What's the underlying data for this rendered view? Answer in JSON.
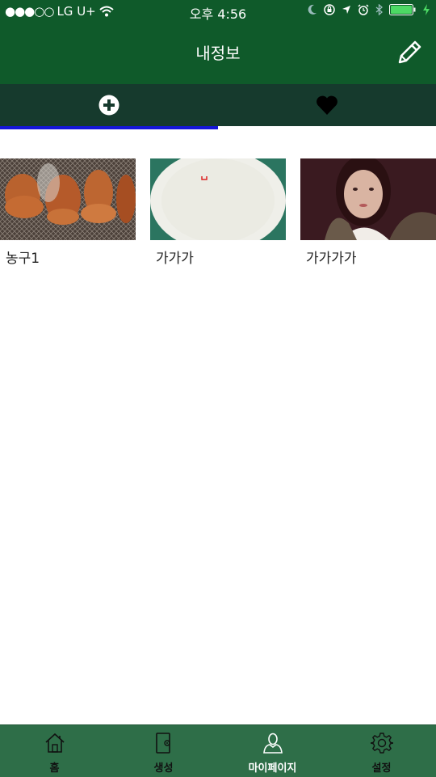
{
  "status_bar": {
    "signal": "●●●○○",
    "carrier": "LG U+",
    "time": "오후 4:56",
    "battery_color": "#4cd964"
  },
  "header": {
    "title": "내정보",
    "edit_icon": "pencil-icon"
  },
  "tabs": [
    {
      "icon": "plus-circle-icon",
      "active": true
    },
    {
      "icon": "heart-icon",
      "active": false
    }
  ],
  "items": [
    {
      "title": "농구1",
      "image": "grilled-meat-photo"
    },
    {
      "title": "가가가",
      "image": "white-plate-photo"
    },
    {
      "title": "가가가가",
      "image": "person-photo"
    }
  ],
  "bottom_nav": [
    {
      "label": "홈",
      "icon": "home-icon"
    },
    {
      "label": "생성",
      "icon": "create-icon"
    },
    {
      "label": "마이페이지",
      "icon": "user-icon",
      "active": true
    },
    {
      "label": "설정",
      "icon": "gear-icon"
    }
  ],
  "colors": {
    "primary": "#0f5a2a",
    "tab_bar": "#163a2d",
    "tab_indicator": "#1515d9",
    "bottom_nav": "#2e6e48"
  }
}
